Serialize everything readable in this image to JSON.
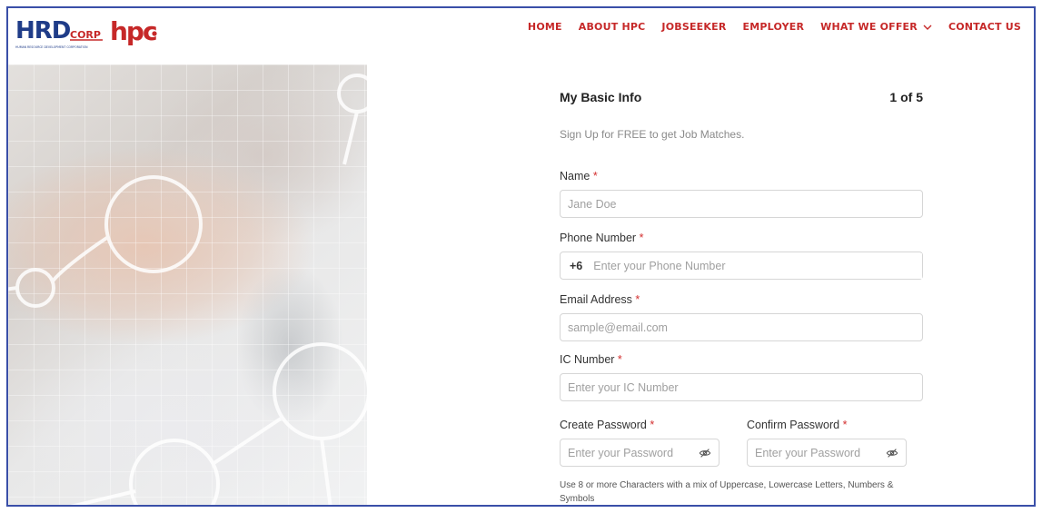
{
  "brand": {
    "hrd_text": "HRD",
    "corp_text": "CORP",
    "tagline": "HUMAN RESOURCE DEVELOPMENT CORPORATION",
    "hpc_text": "hpc",
    "colors": {
      "navy": "#1f3c88",
      "red": "#c62828"
    }
  },
  "nav": {
    "items": [
      {
        "label": "HOME"
      },
      {
        "label": "ABOUT HPC"
      },
      {
        "label": "JOBSEEKER"
      },
      {
        "label": "EMPLOYER"
      },
      {
        "label": "WHAT WE OFFER",
        "icon": "chevron-down-icon"
      },
      {
        "label": "CONTACT US"
      }
    ]
  },
  "form": {
    "title": "My Basic Info",
    "step": "1 of 5",
    "subtitle": "Sign Up for FREE to get Job Matches.",
    "required_mark": "*",
    "name": {
      "label": "Name",
      "placeholder": "Jane Doe"
    },
    "phone": {
      "label": "Phone Number",
      "prefix": "+6",
      "placeholder": "Enter your Phone Number"
    },
    "email": {
      "label": "Email Address",
      "placeholder": "sample@email.com"
    },
    "ic": {
      "label": "IC Number",
      "placeholder": "Enter your IC Number"
    },
    "password": {
      "label": "Create Password",
      "placeholder": "Enter your Password",
      "icon": "eye-off-icon"
    },
    "confirm_password": {
      "label": "Confirm Password",
      "placeholder": "Enter your Password",
      "icon": "eye-off-icon"
    },
    "password_hint": "Use 8 or more Characters with a mix of Uppercase, Lowercase Letters, Numbers & Symbols"
  }
}
